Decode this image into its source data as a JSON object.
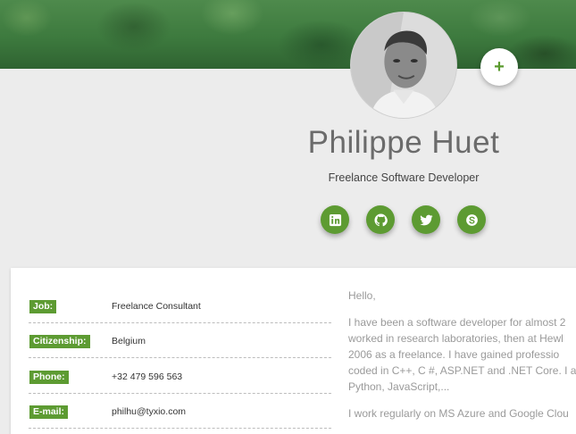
{
  "header": {
    "banner": "forest-banner",
    "add_button_label": "+"
  },
  "profile": {
    "name": "Philippe Huet",
    "title": "Freelance Software Developer"
  },
  "social": [
    {
      "icon": "linkedin-icon"
    },
    {
      "icon": "github-icon"
    },
    {
      "icon": "twitter-icon"
    },
    {
      "icon": "skype-icon"
    }
  ],
  "details": [
    {
      "label": "Job:",
      "value": "Freelance Consultant"
    },
    {
      "label": "Citizenship:",
      "value": "Belgium"
    },
    {
      "label": "Phone:",
      "value": "+32 479 596 563"
    },
    {
      "label": "E-mail:",
      "value": "philhu@tyxio.com"
    }
  ],
  "bio": {
    "greeting": "Hello,",
    "paragraph1_lines": [
      "I have been a software developer for almost 2",
      "worked in research laboratories, then at Hewl",
      "2006 as a freelance. I have gained professio",
      "coded in C++, C #, ASP.NET and .NET Core. I a",
      "Python, JavaScript,..."
    ],
    "paragraph2_line": "I work regularly on MS Azure and Google Clou"
  },
  "colors": {
    "accent": "#5d9b32",
    "background": "#ececec",
    "card": "#ffffff"
  }
}
